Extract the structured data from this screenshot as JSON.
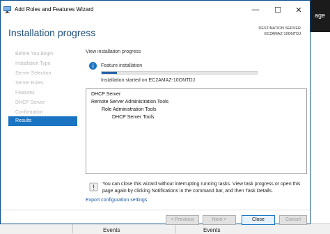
{
  "background": {
    "title_fragment": "age",
    "events": [
      "Events",
      "Events"
    ]
  },
  "window": {
    "title": "Add Roles and Features Wizard",
    "minimize_glyph": "—",
    "maximize_glyph": "☐",
    "close_glyph": "✕"
  },
  "header": {
    "page_title": "Installation progress",
    "destination_label": "DESTINATION SERVER",
    "destination_server": "EC2AMAZ-10ONTDJ"
  },
  "nav": {
    "items": [
      {
        "label": "Before You Begin",
        "active": false
      },
      {
        "label": "Installation Type",
        "active": false
      },
      {
        "label": "Server Selection",
        "active": false
      },
      {
        "label": "Server Roles",
        "active": false
      },
      {
        "label": "Features",
        "active": false
      },
      {
        "label": "DHCP Server",
        "active": false
      },
      {
        "label": "Confirmation",
        "active": false
      },
      {
        "label": "Results",
        "active": true
      }
    ]
  },
  "main": {
    "view_label": "View installation progress",
    "feature_label": "Feature installation",
    "progress_fraction": 0.1,
    "started_text": "Installation started on EC2AMAZ-10ONTDJ",
    "results": [
      {
        "text": "DHCP Server",
        "indent": 0
      },
      {
        "text": "Remote Server Administration Tools",
        "indent": 0
      },
      {
        "text": "Role Administration Tools",
        "indent": 1
      },
      {
        "text": "DHCP Server Tools",
        "indent": 2
      }
    ],
    "note": "You can close this wizard without interrupting running tasks. View task progress or open this page again by clicking Notifications in the command bar, and then Task Details.",
    "export_link": "Export configuration settings"
  },
  "buttons": {
    "previous": "< Previous",
    "next": "Next >",
    "close": "Close",
    "cancel": "Cancel"
  },
  "colors": {
    "accent": "#1a74c2",
    "title": "#1f4e79",
    "progress": "#1f5fa8"
  }
}
